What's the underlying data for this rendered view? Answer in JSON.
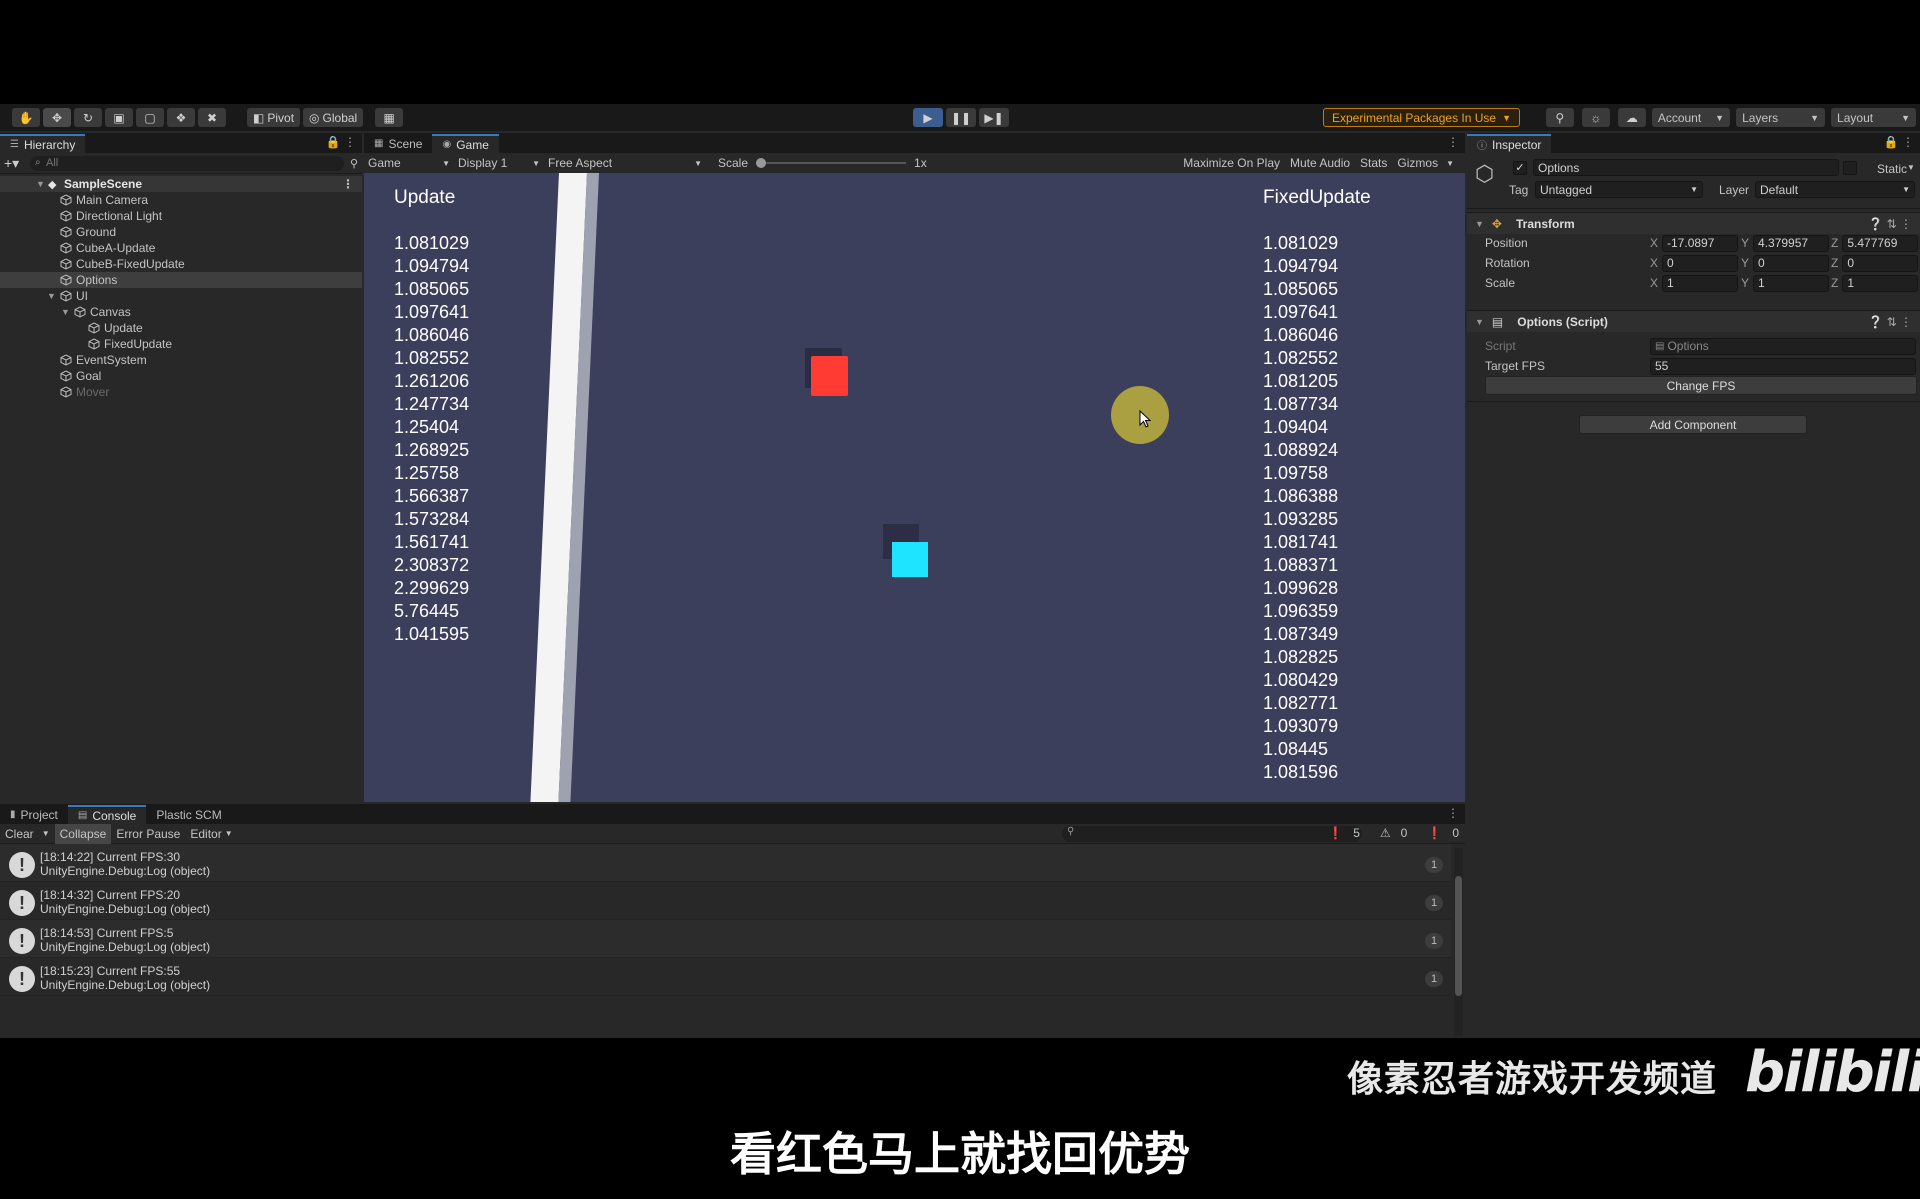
{
  "toolbar": {
    "pivot": "Pivot",
    "global": "Global",
    "experimental": "Experimental Packages In Use",
    "account": "Account",
    "layers": "Layers",
    "layout": "Layout"
  },
  "hierarchy": {
    "tab": "Hierarchy",
    "search_placeholder": "All",
    "scene": "SampleScene",
    "items": [
      {
        "label": "Main Camera",
        "depth": 1
      },
      {
        "label": "Directional Light",
        "depth": 1
      },
      {
        "label": "Ground",
        "depth": 1
      },
      {
        "label": "CubeA-Update",
        "depth": 1
      },
      {
        "label": "CubeB-FixedUpdate",
        "depth": 1
      },
      {
        "label": "Options",
        "depth": 1,
        "selected": true
      },
      {
        "label": "UI",
        "depth": 1,
        "expanded": true
      },
      {
        "label": "Canvas",
        "depth": 2,
        "expanded": true
      },
      {
        "label": "Update",
        "depth": 3
      },
      {
        "label": "FixedUpdate",
        "depth": 3
      },
      {
        "label": "EventSystem",
        "depth": 1
      },
      {
        "label": "Goal",
        "depth": 1
      },
      {
        "label": "Mover",
        "depth": 1,
        "disabled": true
      }
    ]
  },
  "game": {
    "tabs": {
      "scene": "Scene",
      "game": "Game"
    },
    "bar": {
      "mode": "Game",
      "display": "Display 1",
      "aspect": "Free Aspect",
      "scale_label": "Scale",
      "scale_value": "1x",
      "maximize": "Maximize On Play",
      "mute": "Mute Audio",
      "stats": "Stats",
      "gizmos": "Gizmos"
    },
    "update_title": "Update",
    "fixed_title": "FixedUpdate",
    "update_values": [
      "1.081029",
      "1.094794",
      "1.085065",
      "1.097641",
      "1.086046",
      "1.082552",
      "1.261206",
      "1.247734",
      "1.25404",
      "1.268925",
      "1.25758",
      "1.566387",
      "1.573284",
      "1.561741",
      "2.308372",
      "2.299629",
      "5.76445",
      "1.041595"
    ],
    "fixed_values": [
      "1.081029",
      "1.094794",
      "1.085065",
      "1.097641",
      "1.086046",
      "1.082552",
      "1.081205",
      "1.087734",
      "1.09404",
      "1.088924",
      "1.09758",
      "1.086388",
      "1.093285",
      "1.081741",
      "1.088371",
      "1.099628",
      "1.096359",
      "1.087349",
      "1.082825",
      "1.080429",
      "1.082771",
      "1.093079",
      "1.08445",
      "1.081596"
    ]
  },
  "inspector": {
    "tab": "Inspector",
    "object_name": "Options",
    "static_label": "Static",
    "tag_label": "Tag",
    "tag_value": "Untagged",
    "layer_label": "Layer",
    "layer_value": "Default",
    "transform": {
      "title": "Transform",
      "position_label": "Position",
      "rotation_label": "Rotation",
      "scale_label": "Scale",
      "position": {
        "x": "-17.0897",
        "y": "4.379957",
        "z": "5.477769"
      },
      "rotation": {
        "x": "0",
        "y": "0",
        "z": "0"
      },
      "scale": {
        "x": "1",
        "y": "1",
        "z": "1"
      },
      "axis": {
        "x": "X",
        "y": "Y",
        "z": "Z"
      }
    },
    "script_component": {
      "title": "Options (Script)",
      "script_label": "Script",
      "script_value": "Options",
      "target_fps_label": "Target FPS",
      "target_fps_value": "55",
      "change_fps": "Change FPS"
    },
    "add_component": "Add Component"
  },
  "console": {
    "tabs": {
      "project": "Project",
      "console": "Console",
      "plastic": "Plastic SCM"
    },
    "bar": {
      "clear": "Clear",
      "collapse": "Collapse",
      "error_pause": "Error Pause",
      "editor": "Editor"
    },
    "counts": {
      "info": "5",
      "warn": "0",
      "error": "0"
    },
    "logs": [
      {
        "line1": "[18:14:22] Current FPS:30",
        "line2": "UnityEngine.Debug:Log (object)",
        "count": "1"
      },
      {
        "line1": "[18:14:32] Current FPS:20",
        "line2": "UnityEngine.Debug:Log (object)",
        "count": "1"
      },
      {
        "line1": "[18:14:53] Current FPS:5",
        "line2": "UnityEngine.Debug:Log (object)",
        "count": "1"
      },
      {
        "line1": "[18:15:23] Current FPS:55",
        "line2": "UnityEngine.Debug:Log (object)",
        "count": "1"
      }
    ]
  },
  "overlay": {
    "channel": "像素忍者游戏开发频道",
    "logo": "bilibili",
    "subtitle": "看红色马上就找回优势"
  }
}
